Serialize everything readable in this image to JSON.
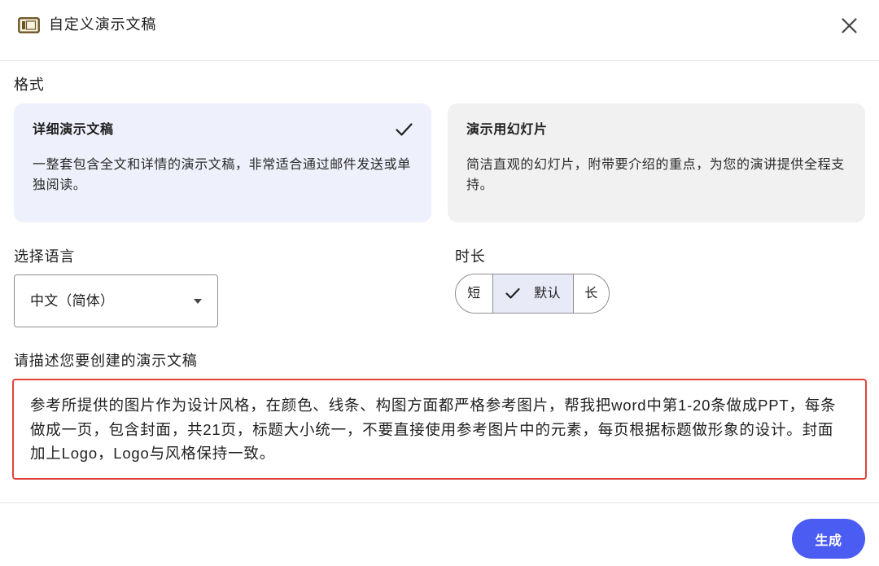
{
  "dialog": {
    "title": "自定义演示文稿",
    "icon": "slides-icon",
    "close_icon": "close-icon"
  },
  "format": {
    "label": "格式",
    "check_icon": "check-icon",
    "options": [
      {
        "title": "详细演示文稿",
        "description": "一整套包含全文和详情的演示文稿，非常适合通过邮件发送或单独阅读。",
        "selected": true
      },
      {
        "title": "演示用幻灯片",
        "description": "简洁直观的幻灯片，附带要介绍的重点，为您的演讲提供全程支持。",
        "selected": false
      }
    ]
  },
  "language": {
    "label": "选择语言",
    "selected": "中文（简体）",
    "dropdown_icon": "arrow-drop-down-icon"
  },
  "duration": {
    "label": "时长",
    "options": [
      {
        "label": "短",
        "selected": false
      },
      {
        "label": "默认",
        "selected": true
      },
      {
        "label": "长",
        "selected": false
      }
    ]
  },
  "prompt": {
    "label": "请描述您要创建的演示文稿",
    "value": "参考所提供的图片作为设计风格，在颜色、线条、构图方面都严格参考图片，帮我把word中第1-20条做成PPT，每条做成一页，包含封面，共21页，标题大小统一，不要直接使用参考图片中的元素，每页根据标题做形象的设计。封面加上Logo，Logo与风格保持一致。"
  },
  "actions": {
    "generate_label": "生成"
  },
  "colors": {
    "accent": "#4b5cf3",
    "selected_bg": "#eef0fb",
    "card_bg": "#f1f1f1",
    "segment_selected_bg": "#e8eaf8",
    "error_border": "#e2413b",
    "control_border": "#8e8e8e",
    "divider": "#e3e3e3",
    "text": "#1f1f1f",
    "icon": "#444444",
    "brand_icon": "#6b5624"
  }
}
